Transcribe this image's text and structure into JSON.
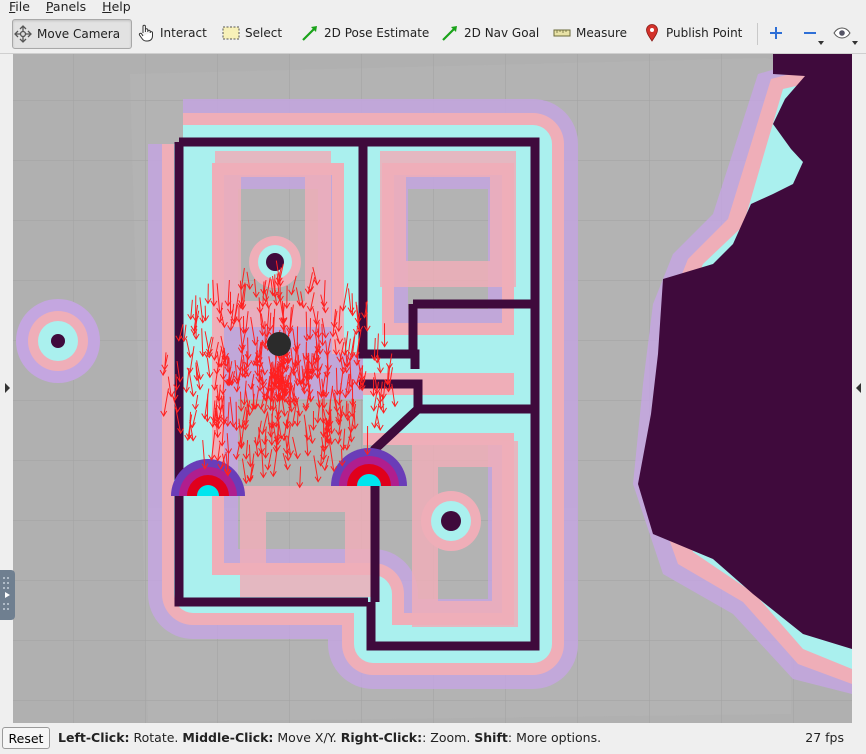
{
  "menubar": {
    "items": [
      {
        "label": "File",
        "mnemonic": "F",
        "rest": "ile"
      },
      {
        "label": "Panels",
        "mnemonic": "P",
        "rest": "anels"
      },
      {
        "label": "Help",
        "mnemonic": "H",
        "rest": "elp"
      }
    ]
  },
  "toolbar": {
    "move_camera": "Move Camera",
    "interact": "Interact",
    "select": "Select",
    "pose_estimate": "2D Pose Estimate",
    "nav_goal": "2D Nav Goal",
    "measure": "Measure",
    "publish_point": "Publish Point",
    "icons": {
      "move_camera": "move-camera-icon",
      "interact": "hand-pointer-icon",
      "select": "selection-rectangle-icon",
      "pose_estimate": "green-arrow-icon",
      "nav_goal": "green-arrow-icon",
      "measure": "ruler-icon",
      "publish_point": "map-pin-icon",
      "add": "plus-icon",
      "remove": "minus-icon",
      "visibility": "eye-icon"
    }
  },
  "status": {
    "reset_label": "Reset",
    "hint_parts": [
      {
        "bold": "Left-Click:",
        "text": " Rotate. "
      },
      {
        "bold": "Middle-Click:",
        "text": " Move X/Y. "
      },
      {
        "bold": "Right-Click:",
        "text": ": Zoom. "
      },
      {
        "bold": "Shift",
        "text": ": More options."
      }
    ],
    "fps": "27 fps"
  },
  "colors": {
    "wall": "#3f0a3c",
    "inflation_cyan": "#aaf0ee",
    "inflation_pink": "#efaeb8",
    "inflation_purple": "#c4a6e0",
    "free_space": "#b3b3b3",
    "particles": "#ff2020",
    "robot": "#2b2b2b",
    "costmap_hot": "#e0001c",
    "costmap_cyan": "#00e5ee"
  }
}
